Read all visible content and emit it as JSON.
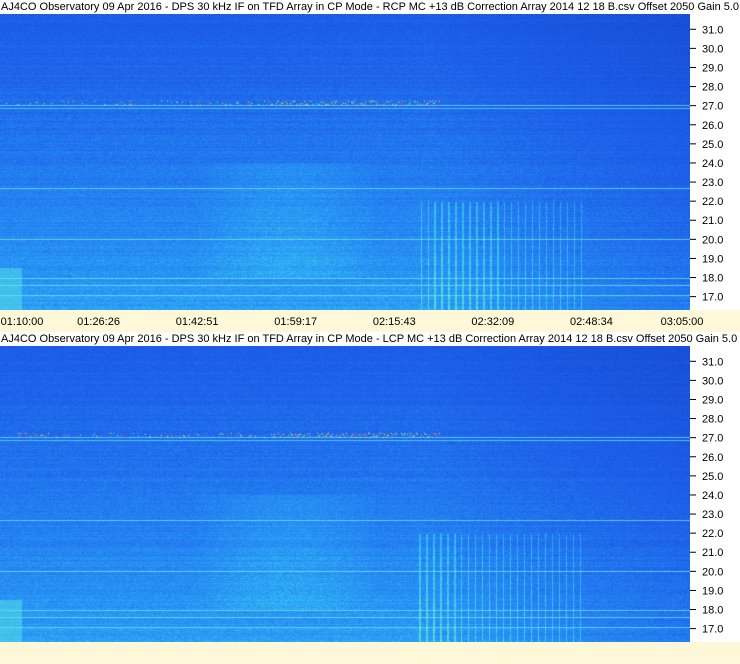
{
  "chart_data": [
    {
      "type": "heatmap",
      "title": "AJ4CO Observatory 09 Apr 2016 - DPS 30 kHz IF on TFD Array in CP Mode - RCP  MC +13 dB  Correction Array 2014 12 18 B.csv  Offset 2050  Gain 5.0",
      "polarization": "RCP",
      "y_ticks": [
        "31.0",
        "30.0",
        "29.0",
        "28.0",
        "27.0",
        "26.0",
        "25.0",
        "24.0",
        "23.0",
        "22.0",
        "21.0",
        "20.0",
        "19.0",
        "18.0",
        "17.0"
      ],
      "x_ticks": [
        "01:10:00",
        "01:26:26",
        "01:42:51",
        "01:59:17",
        "02:15:43",
        "02:32:09",
        "02:48:34",
        "03:05:00"
      ],
      "ylim": [
        16.3,
        31.8
      ],
      "colors": {
        "background": "#1a55d8",
        "mid": "#2b8ff0",
        "high": "#3fd0f0",
        "hot": "#ffe040",
        "peak": "#ff5050"
      }
    },
    {
      "type": "heatmap",
      "title": "AJ4CO Observatory 09 Apr 2016 - DPS 30 kHz IF on TFD Array in CP Mode - LCP  MC +13 dB  Correction Array 2014 12 18 B.csv  Offset 2050  Gain 5.0",
      "polarization": "LCP",
      "y_ticks": [
        "31.0",
        "30.0",
        "29.0",
        "28.0",
        "27.0",
        "26.0",
        "25.0",
        "24.0",
        "23.0",
        "22.0",
        "21.0",
        "20.0",
        "19.0",
        "18.0",
        "17.0"
      ],
      "ylim": [
        16.3,
        31.8
      ],
      "colors": {
        "background": "#1a55d8",
        "mid": "#2b8ff0",
        "high": "#3fd0f0",
        "hot": "#ffe040",
        "peak": "#ff5050"
      }
    }
  ]
}
